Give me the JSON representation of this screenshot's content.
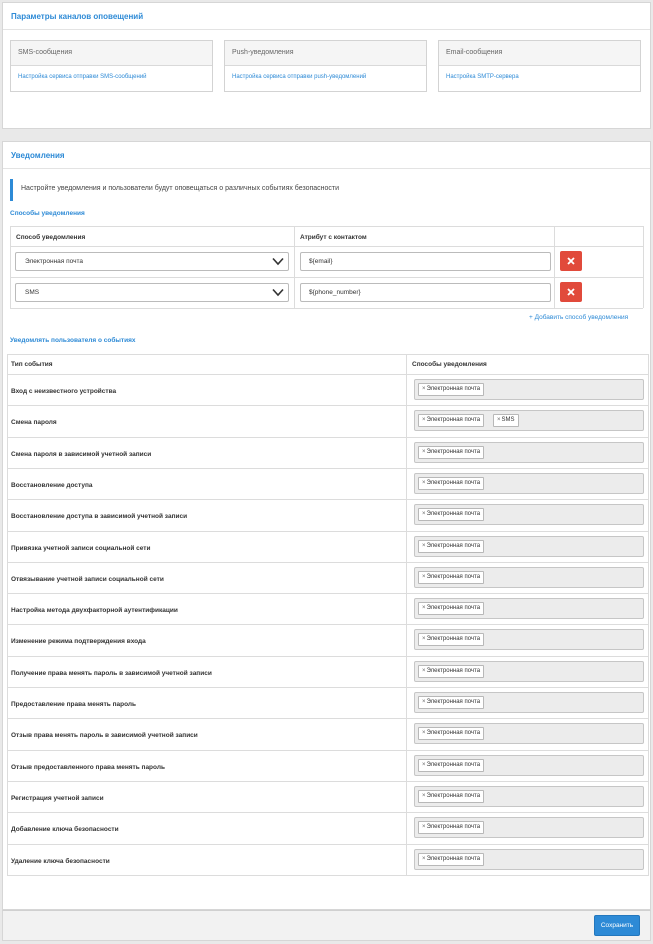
{
  "channels": {
    "title": "Параметры каналов оповещений",
    "cards": [
      {
        "title": "SMS-сообщения",
        "link": "Настройка сервиса отправки SMS-сообщений"
      },
      {
        "title": "Push-уведомления",
        "link": "Настройка сервиса отправки push-уведомлений"
      },
      {
        "title": "Email-сообщения",
        "link": "Настройка SMTP-сервера"
      }
    ]
  },
  "notifications": {
    "title": "Уведомления",
    "callout": "Настройте уведомления и пользователи будут оповещаться о различных событиях безопасности",
    "methods_heading": "Способы уведомления",
    "methods_table": {
      "col_method": "Способ уведомления",
      "col_attr": "Атрибут с контактом",
      "rows": [
        {
          "method": "Электронная почта",
          "attr": "${email}"
        },
        {
          "method": "SMS",
          "attr": "${phone_number}"
        }
      ]
    },
    "add_method": "+ Добавить способ уведомления",
    "events_heading": "Уведомлять пользователя о событиях",
    "events_table": {
      "col_type": "Тип события",
      "col_methods": "Способы уведомления",
      "rows": [
        {
          "name": "Вход с неизвестного устройства",
          "tags": [
            "Электронная почта"
          ]
        },
        {
          "name": "Смена пароля",
          "tags": [
            "Электронная почта",
            "SMS"
          ]
        },
        {
          "name": "Смена пароля в зависимой учетной записи",
          "tags": [
            "Электронная почта"
          ]
        },
        {
          "name": "Восстановление доступа",
          "tags": [
            "Электронная почта"
          ]
        },
        {
          "name": "Восстановление доступа в зависимой учетной записи",
          "tags": [
            "Электронная почта"
          ]
        },
        {
          "name": "Привязка учетной записи социальной сети",
          "tags": [
            "Электронная почта"
          ]
        },
        {
          "name": "Отвязывание учетной записи социальной сети",
          "tags": [
            "Электронная почта"
          ]
        },
        {
          "name": "Настройка метода двухфакторной аутентификации",
          "tags": [
            "Электронная почта"
          ]
        },
        {
          "name": "Изменение режима подтверждения входа",
          "tags": [
            "Электронная почта"
          ]
        },
        {
          "name": "Получение права менять пароль в зависимой учетной записи",
          "tags": [
            "Электронная почта"
          ]
        },
        {
          "name": "Предоставление права менять пароль",
          "tags": [
            "Электронная почта"
          ]
        },
        {
          "name": "Отзыв права менять пароль в зависимой учетной записи",
          "tags": [
            "Электронная почта"
          ]
        },
        {
          "name": "Отзыв предоставленного права менять пароль",
          "tags": [
            "Электронная почта"
          ]
        },
        {
          "name": "Регистрация учетной записи",
          "tags": [
            "Электронная почта"
          ]
        },
        {
          "name": "Добавление ключа безопасности",
          "tags": [
            "Электронная почта"
          ]
        },
        {
          "name": "Удаление ключа безопасности",
          "tags": [
            "Электронная почта"
          ]
        }
      ]
    }
  },
  "footer": {
    "save_label": "Сохранить"
  },
  "colors": {
    "accent": "#2d8ad6",
    "danger": "#e14a3b"
  }
}
